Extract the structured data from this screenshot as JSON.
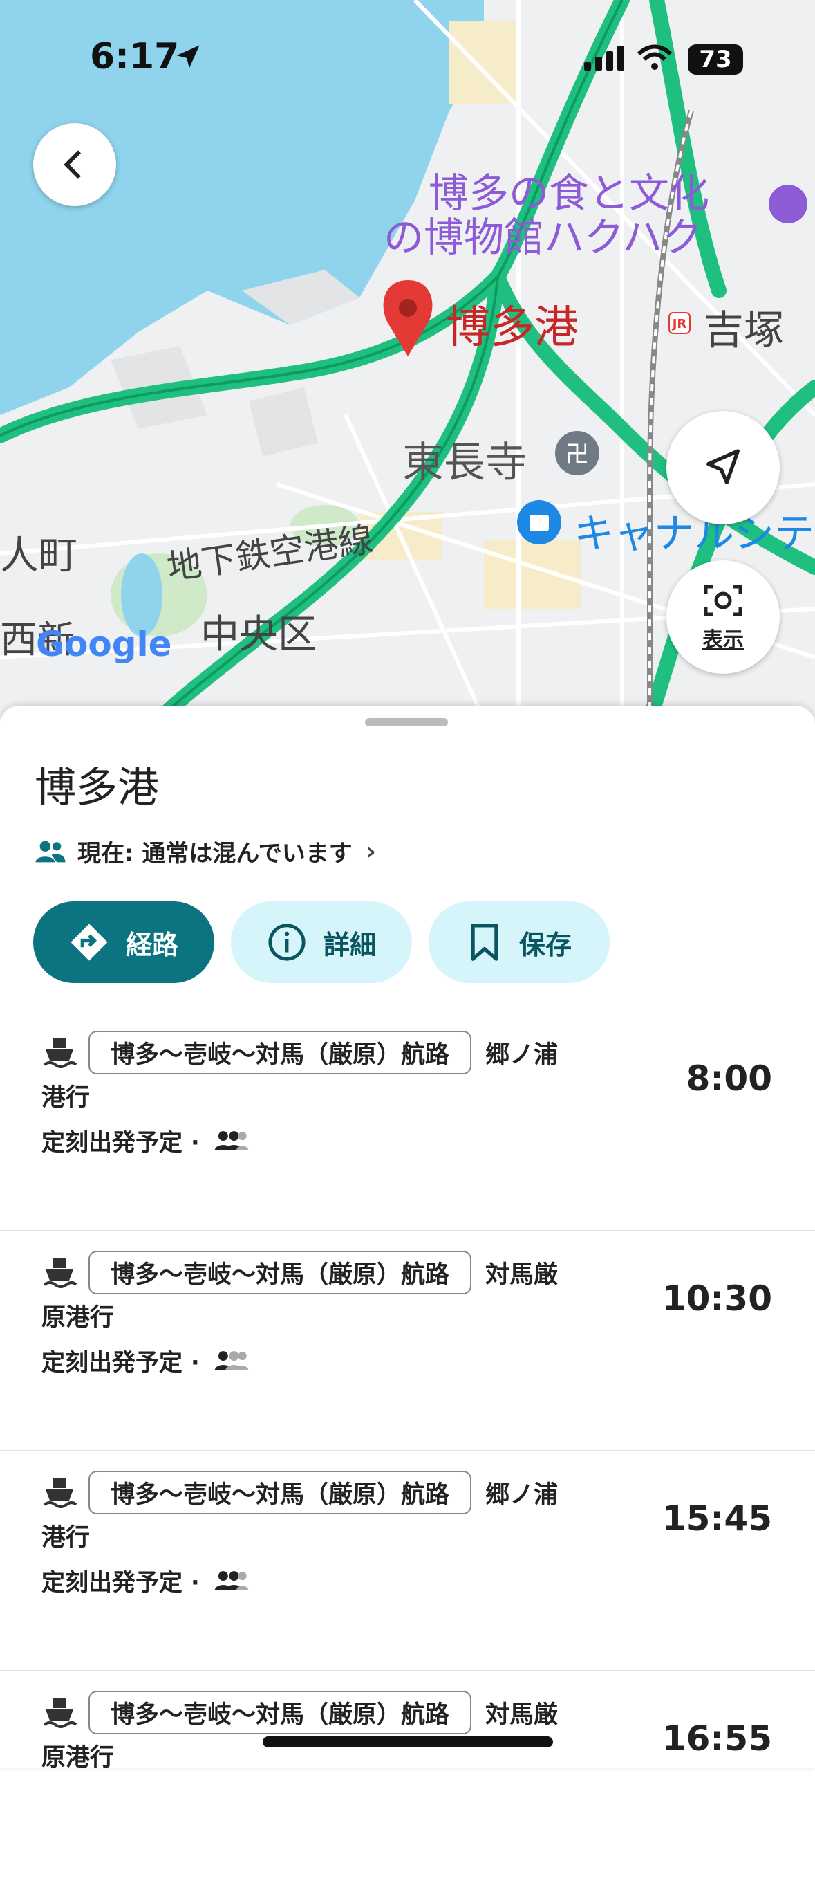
{
  "status_bar": {
    "time": "6:17",
    "battery": "73"
  },
  "map": {
    "labels": {
      "museum": "博多の食と文化",
      "museum2": "の博物館ハクハク",
      "pin": "博多港",
      "yoshizuka": "吉塚",
      "tochoji": "東長寺",
      "canal": "キャナルシテ",
      "subway": "地下鉄空港線",
      "chuo": "中央区",
      "hitomachi": "人町",
      "nishi": "西新",
      "google": "Google"
    },
    "lens_label": "表示"
  },
  "sheet": {
    "title": "博多港",
    "crowd_text": "現在: 通常は混んでいます",
    "buttons": {
      "route": "経路",
      "details": "詳細",
      "save": "保存"
    },
    "departures": [
      {
        "route": "博多〜壱岐〜対馬（厳原）航路",
        "dest_line1": "郷ノ浦",
        "dest_line2": "港行",
        "status": "定刻出発予定 ·",
        "time": "8:00"
      },
      {
        "route": "博多〜壱岐〜対馬（厳原）航路",
        "dest_line1": "対馬厳",
        "dest_line2": "原港行",
        "status": "定刻出発予定 ·",
        "time": "10:30"
      },
      {
        "route": "博多〜壱岐〜対馬（厳原）航路",
        "dest_line1": "郷ノ浦",
        "dest_line2": "港行",
        "status": "定刻出発予定 ·",
        "time": "15:45"
      },
      {
        "route": "博多〜壱岐〜対馬（厳原）航路",
        "dest_line1": "対馬厳",
        "dest_line2": "原港行",
        "status": "",
        "time": "16:55"
      }
    ]
  },
  "colors": {
    "accent": "#0b7480",
    "accent_light": "#d5f5fb",
    "water": "#8fd4ec",
    "road": "#1fbf7f",
    "pin": "#e53935"
  }
}
